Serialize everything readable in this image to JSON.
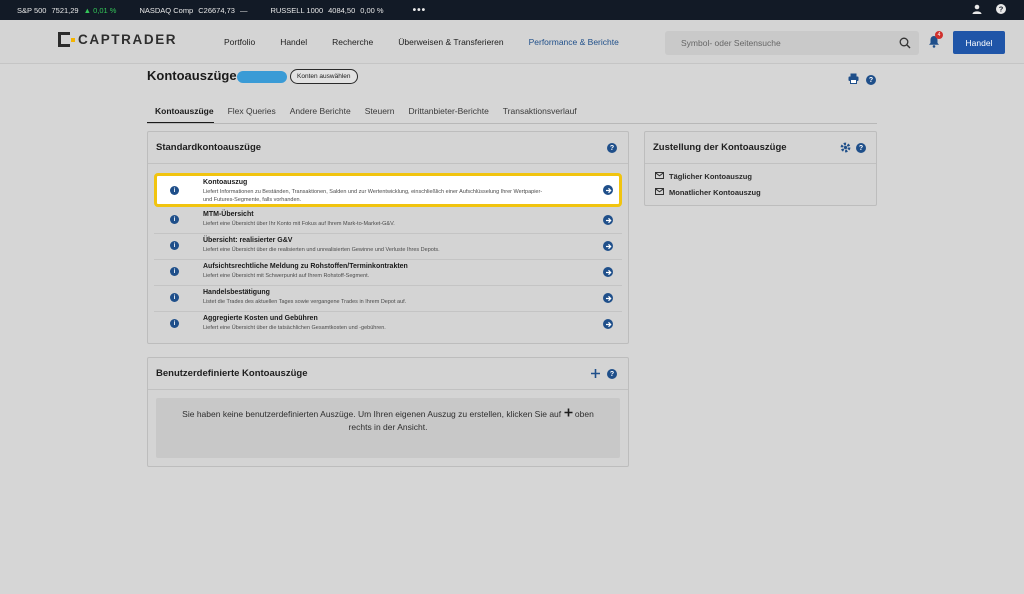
{
  "ticker": {
    "items": [
      {
        "name": "S&P 500",
        "value": "7521,29",
        "change": "▲ 0,01 %",
        "change_type": "up"
      },
      {
        "name": "NASDAQ Comp",
        "value": "C26674,73",
        "change": "—",
        "change_type": "flat"
      },
      {
        "name": "RUSSELL 1000",
        "value": "4084,50",
        "change": "0,00 %",
        "change_type": "flat"
      }
    ],
    "more": "•••",
    "user_icon": "user-icon",
    "help_icon": "help-icon"
  },
  "header": {
    "logo_text": "CAPTRADER",
    "nav": [
      "Portfolio",
      "Handel",
      "Recherche",
      "Überweisen & Transferieren",
      "Performance & Berichte"
    ],
    "active_nav_index": 4,
    "search_placeholder": "Symbol- oder Seitensuche",
    "notification_count": "4",
    "trade_button": "Handel"
  },
  "page": {
    "title": "Kontoauszüge",
    "accounts_button": "Konten auswählen"
  },
  "tabs": [
    "Kontoauszüge",
    "Flex Queries",
    "Andere Berichte",
    "Steuern",
    "Drittanbieter-Berichte",
    "Transaktionsverlauf"
  ],
  "standard": {
    "title": "Standardkontoauszüge",
    "rows": [
      {
        "title": "Kontoauszug",
        "desc": "Liefert Informationen zu Beständen, Transaktionen, Salden und zur Wertentwicklung, einschließlich einer Aufschlüsselung Ihrer Wertpapier- und Futures-Segmente, falls vorhanden."
      },
      {
        "title": "MTM-Übersicht",
        "desc": "Liefert eine Übersicht über Ihr Konto mit Fokus auf Ihrem Mark-to-Market-G&V."
      },
      {
        "title": "Übersicht: realisierter G&V",
        "desc": "Liefert eine Übersicht über die realisierten und unrealisierten Gewinne und Verluste Ihres Depots."
      },
      {
        "title": "Aufsichtsrechtliche Meldung zu Rohstoffen/Terminkontrakten",
        "desc": "Liefert eine Übersicht mit Schwerpunkt auf Ihrem Rohstoff-Segment."
      },
      {
        "title": "Handelsbestätigung",
        "desc": "Listet die Trades des aktuellen Tages sowie vergangene Trades in Ihrem Depot auf."
      },
      {
        "title": "Aggregierte Kosten und Gebühren",
        "desc": "Liefert eine Übersicht über die tatsächlichen Gesamtkosten und -gebühren."
      }
    ]
  },
  "custom": {
    "title": "Benutzerdefinierte Kontoauszüge",
    "empty_before": "Sie haben keine benutzerdefinierten Auszüge. Um Ihren eigenen Auszug zu erstellen, klicken Sie auf",
    "empty_after": "oben rechts in der Ansicht."
  },
  "delivery": {
    "title": "Zustellung der Kontoauszüge",
    "items": [
      "Täglicher Kontoauszug",
      "Monatlicher Kontoauszug"
    ]
  },
  "colors": {
    "accent": "#1f4f8a",
    "highlight": "#f1c40f",
    "trade_button": "#1f55a8",
    "ticker_bg": "#121a26"
  }
}
